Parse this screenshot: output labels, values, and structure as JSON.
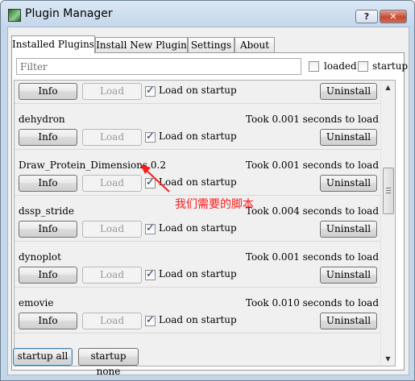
{
  "window": {
    "title": "Plugin Manager",
    "help_label": "?",
    "close_label": "✕"
  },
  "tabs": [
    {
      "label": "Installed Plugins",
      "active": true
    },
    {
      "label": "Install New Plugin",
      "active": false
    },
    {
      "label": "Settings",
      "active": false
    },
    {
      "label": "About",
      "active": false
    }
  ],
  "filter": {
    "placeholder": "Filter",
    "value": "",
    "loaded_label": "loaded",
    "loaded_checked": false,
    "startup_label": "startup",
    "startup_checked": false
  },
  "plugin_buttons": {
    "info": "Info",
    "load": "Load",
    "uninstall": "Uninstall",
    "load_on_startup": "Load on startup"
  },
  "plugins": [
    {
      "name": "",
      "time": "",
      "load_on_startup": true,
      "load_enabled": false
    },
    {
      "name": "dehydron",
      "time": "Took 0.001 seconds to load",
      "load_on_startup": true,
      "load_enabled": false
    },
    {
      "name": "Draw_Protein_Dimensions 0.2",
      "time": "Took 0.001 seconds to load",
      "load_on_startup": true,
      "load_enabled": false
    },
    {
      "name": "dssp_stride",
      "time": "Took 0.004 seconds to load",
      "load_on_startup": true,
      "load_enabled": false
    },
    {
      "name": "dynoplot",
      "time": "Took 0.001 seconds to load",
      "load_on_startup": true,
      "load_enabled": false
    },
    {
      "name": "emovie",
      "time": "Took 0.010 seconds to load",
      "load_on_startup": true,
      "load_enabled": false
    }
  ],
  "footer": {
    "startup_all": "startup all",
    "startup_none": "startup none"
  },
  "annotation": {
    "text": "我们需要的脚本",
    "color": "#ff1a1a"
  }
}
